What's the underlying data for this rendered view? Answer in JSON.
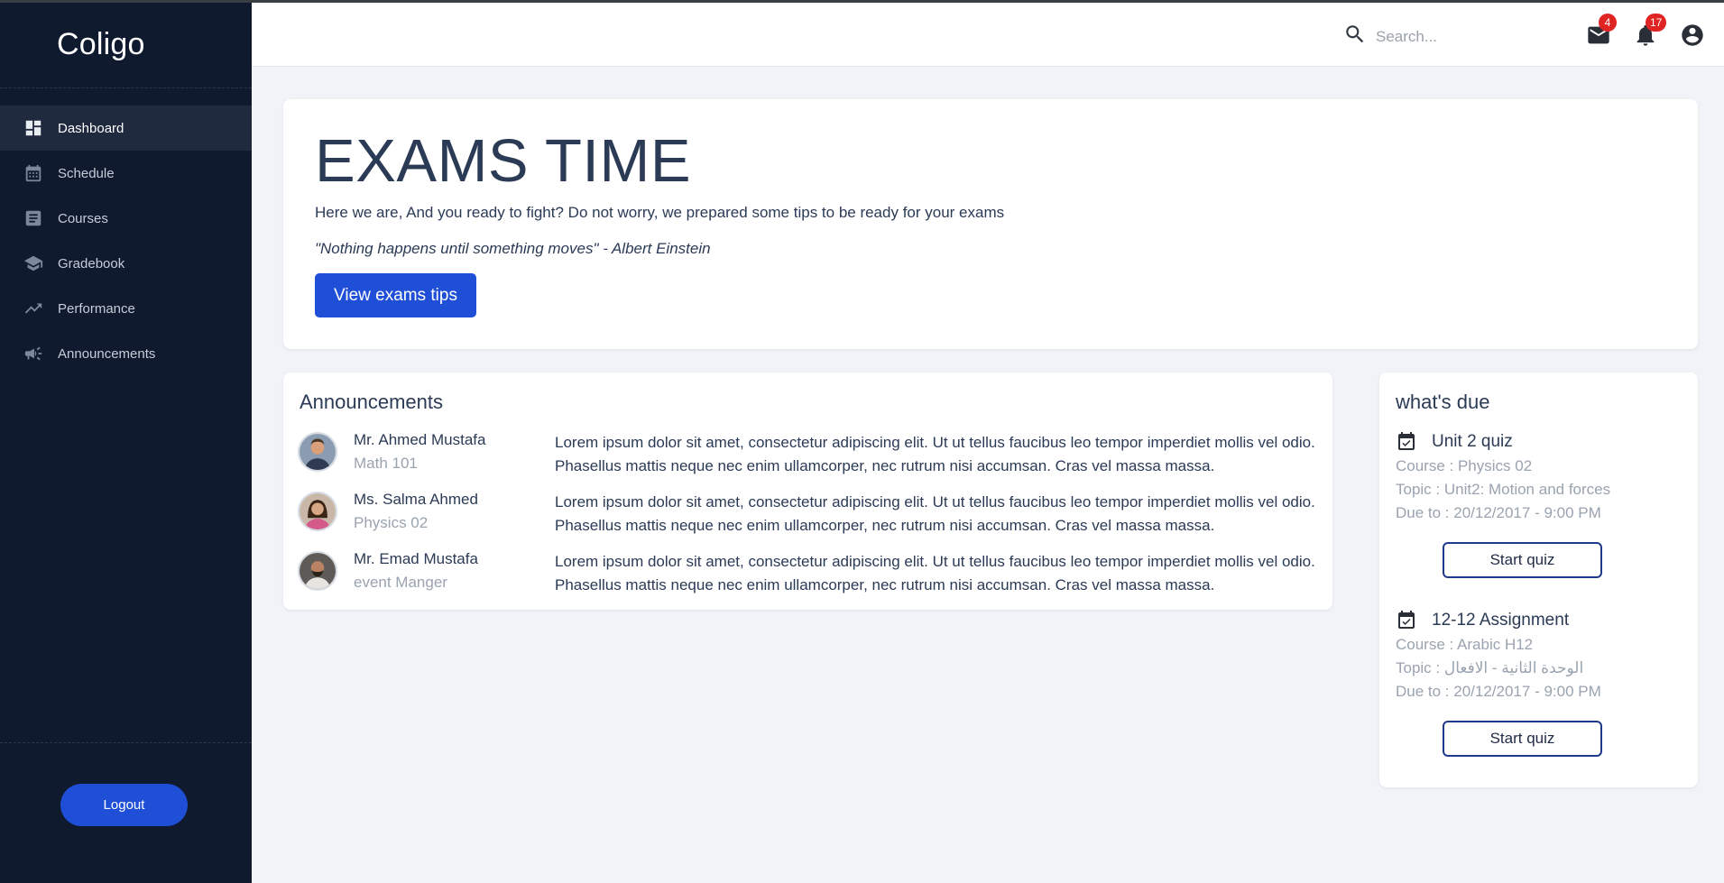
{
  "app": {
    "name": "Coligo"
  },
  "sidebar": {
    "items": [
      {
        "label": "Dashboard",
        "icon": "dashboard-icon",
        "active": true
      },
      {
        "label": "Schedule",
        "icon": "calendar-icon"
      },
      {
        "label": "Courses",
        "icon": "courses-icon"
      },
      {
        "label": "Gradebook",
        "icon": "graduation-cap-icon"
      },
      {
        "label": "Performance",
        "icon": "trending-up-icon"
      },
      {
        "label": "Announcements",
        "icon": "megaphone-icon"
      }
    ],
    "logout_label": "Logout"
  },
  "topbar": {
    "search_placeholder": "Search...",
    "mail_count": "4",
    "notification_count": "17"
  },
  "hero": {
    "title": "EXAMS TIME",
    "description": "Here we are, And you ready to fight? Do not worry, we prepared some tips to be ready for your exams",
    "quote": "\"Nothing happens until something moves\" - Albert Einstein",
    "button_label": "View exams tips"
  },
  "announcements": {
    "title": "Announcements",
    "items": [
      {
        "name": "Mr. Ahmed Mustafa",
        "subtitle": "Math 101",
        "text": "Lorem ipsum dolor sit amet, consectetur adipiscing elit. Ut ut tellus faucibus leo tempor imperdiet mollis vel odio. Phasellus mattis neque nec enim ullamcorper, nec rutrum nisi accumsan. Cras vel massa massa."
      },
      {
        "name": "Ms. Salma Ahmed",
        "subtitle": "Physics 02",
        "text": "Lorem ipsum dolor sit amet, consectetur adipiscing elit. Ut ut tellus faucibus leo tempor imperdiet mollis vel odio. Phasellus mattis neque nec enim ullamcorper, nec rutrum nisi accumsan. Cras vel massa massa."
      },
      {
        "name": "Mr. Emad Mustafa",
        "subtitle": "event Manger",
        "text": "Lorem ipsum dolor sit amet, consectetur adipiscing elit. Ut ut tellus faucibus leo tempor imperdiet mollis vel odio. Phasellus mattis neque nec enim ullamcorper, nec rutrum nisi accumsan. Cras vel massa massa."
      }
    ]
  },
  "due": {
    "title": "what's due",
    "items": [
      {
        "title": "Unit 2 quiz",
        "course": "Course : Physics 02",
        "topic": "Topic : Unit2: Motion and forces",
        "due": "Due to : 20/12/2017 - 9:00 PM",
        "button_label": "Start quiz"
      },
      {
        "title": "12-12 Assignment",
        "course": "Course : Arabic H12",
        "topic": "Topic : الوحدة الثانية - الافعال",
        "due": "Due to : 20/12/2017 - 9:00 PM",
        "button_label": "Start quiz"
      }
    ]
  },
  "colors": {
    "sidebar": "#0f1a2f",
    "primary": "#1f4fd6",
    "badge": "#e02424",
    "background": "#f0f3f7"
  }
}
